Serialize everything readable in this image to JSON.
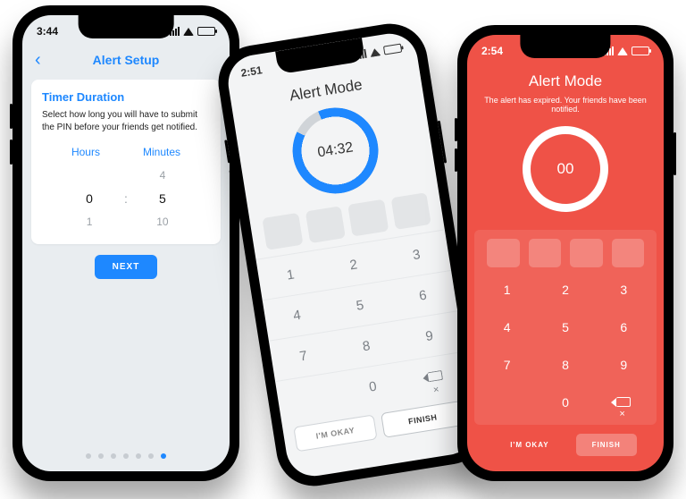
{
  "phone1": {
    "status_time": "3:44",
    "nav": {
      "title": "Alert Setup"
    },
    "card": {
      "heading": "Timer Duration",
      "body": "Select how long you will have to submit the PIN before your friends get notified."
    },
    "picker": {
      "hours_label": "Hours",
      "minutes_label": "Minutes",
      "hours_above": "",
      "hours_sel": "0",
      "hours_below": "1",
      "mins_above": "4",
      "mins_sel": "5",
      "mins_below": "10"
    },
    "next_label": "NEXT",
    "page_dots": {
      "count": 7,
      "active_index": 6
    }
  },
  "phone2": {
    "status_time": "2:51",
    "title": "Alert Mode",
    "timer": "04:32",
    "pin_slots": 4,
    "keypad": [
      "1",
      "2",
      "3",
      "4",
      "5",
      "6",
      "7",
      "8",
      "9",
      "",
      "0",
      "⌫"
    ],
    "ok_label": "I'M OKAY",
    "finish_label": "FINISH"
  },
  "phone3": {
    "status_time": "2:54",
    "title": "Alert Mode",
    "subtitle": "The alert has expired. Your friends have been notified.",
    "timer": "00",
    "pin_slots": 4,
    "keypad": [
      "1",
      "2",
      "3",
      "4",
      "5",
      "6",
      "7",
      "8",
      "9",
      "",
      "0",
      "⌫"
    ],
    "ok_label": "I'M OKAY",
    "finish_label": "FINISH"
  },
  "colors": {
    "accent": "#1e88ff",
    "danger": "#ef5247"
  }
}
